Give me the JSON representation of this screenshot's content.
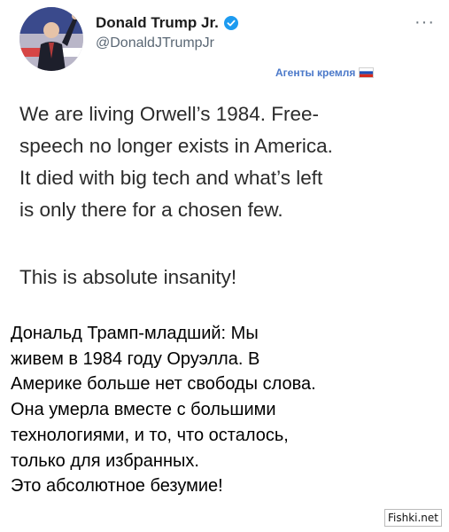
{
  "tweet": {
    "author_name": "Donald Trump Jr.",
    "handle": "@DonaldJTrumpJr",
    "more_icon": "more-horizontal-icon",
    "verified_icon": "verified-badge-icon",
    "overlay_label": "Агенты кремля",
    "flag_icon": "russian-flag-icon",
    "text_lines": [
      "We are living Orwell’s 1984. Free-",
      "speech no longer exists in America.",
      "It died with big tech and what’s left",
      "is only there for a chosen few."
    ],
    "closing_line": "This is absolute insanity!"
  },
  "translation": {
    "lines": [
      "Дональд Трамп-младший: Мы",
      "живем в 1984 году Оруэлла. В",
      "Америке больше нет свободы слова.",
      "Она умерла вместе с большими",
      "технологиями, и то, что осталось,",
      "только для избранных.",
      "Это абсолютное безумие!"
    ]
  },
  "watermark": "Fishki.net",
  "colors": {
    "verified_blue": "#1d9bf0",
    "overlay_blue": "#4a78c9",
    "text_dark": "#2b2b2b"
  }
}
